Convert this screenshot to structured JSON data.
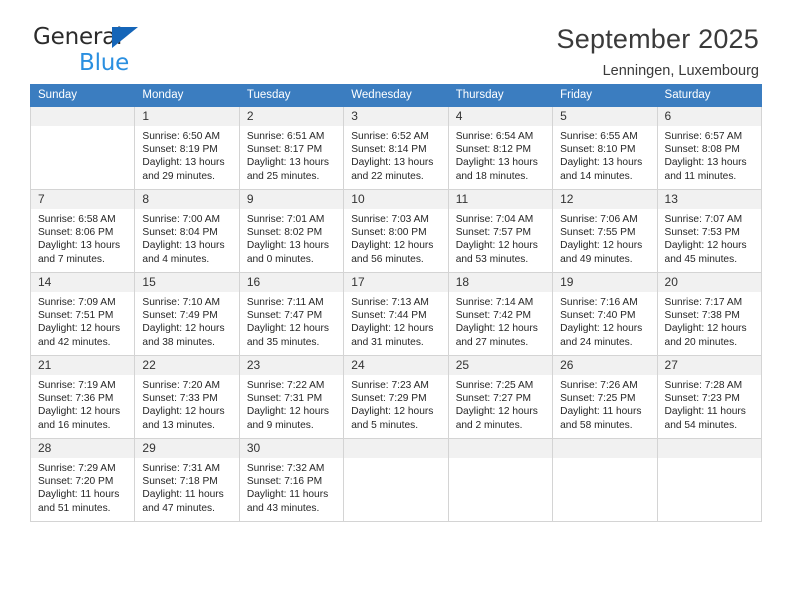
{
  "brand": {
    "line1": "General",
    "line2": "Blue",
    "triangle_color": "#1565b8",
    "blue_text_color": "#2a8fe0"
  },
  "header": {
    "title": "September 2025",
    "subtitle": "Lenningen, Luxembourg",
    "header_bg_color": "#3b7dc0",
    "daynum_bg_color": "#f1f1f1"
  },
  "weekday_headers": [
    "Sunday",
    "Monday",
    "Tuesday",
    "Wednesday",
    "Thursday",
    "Friday",
    "Saturday"
  ],
  "weeks": [
    [
      {
        "day": ""
      },
      {
        "day": "1",
        "sunrise": "Sunrise: 6:50 AM",
        "sunset": "Sunset: 8:19 PM",
        "daylight_1": "Daylight: 13 hours",
        "daylight_2": "and 29 minutes."
      },
      {
        "day": "2",
        "sunrise": "Sunrise: 6:51 AM",
        "sunset": "Sunset: 8:17 PM",
        "daylight_1": "Daylight: 13 hours",
        "daylight_2": "and 25 minutes."
      },
      {
        "day": "3",
        "sunrise": "Sunrise: 6:52 AM",
        "sunset": "Sunset: 8:14 PM",
        "daylight_1": "Daylight: 13 hours",
        "daylight_2": "and 22 minutes."
      },
      {
        "day": "4",
        "sunrise": "Sunrise: 6:54 AM",
        "sunset": "Sunset: 8:12 PM",
        "daylight_1": "Daylight: 13 hours",
        "daylight_2": "and 18 minutes."
      },
      {
        "day": "5",
        "sunrise": "Sunrise: 6:55 AM",
        "sunset": "Sunset: 8:10 PM",
        "daylight_1": "Daylight: 13 hours",
        "daylight_2": "and 14 minutes."
      },
      {
        "day": "6",
        "sunrise": "Sunrise: 6:57 AM",
        "sunset": "Sunset: 8:08 PM",
        "daylight_1": "Daylight: 13 hours",
        "daylight_2": "and 11 minutes."
      }
    ],
    [
      {
        "day": "7",
        "sunrise": "Sunrise: 6:58 AM",
        "sunset": "Sunset: 8:06 PM",
        "daylight_1": "Daylight: 13 hours",
        "daylight_2": "and 7 minutes."
      },
      {
        "day": "8",
        "sunrise": "Sunrise: 7:00 AM",
        "sunset": "Sunset: 8:04 PM",
        "daylight_1": "Daylight: 13 hours",
        "daylight_2": "and 4 minutes."
      },
      {
        "day": "9",
        "sunrise": "Sunrise: 7:01 AM",
        "sunset": "Sunset: 8:02 PM",
        "daylight_1": "Daylight: 13 hours",
        "daylight_2": "and 0 minutes."
      },
      {
        "day": "10",
        "sunrise": "Sunrise: 7:03 AM",
        "sunset": "Sunset: 8:00 PM",
        "daylight_1": "Daylight: 12 hours",
        "daylight_2": "and 56 minutes."
      },
      {
        "day": "11",
        "sunrise": "Sunrise: 7:04 AM",
        "sunset": "Sunset: 7:57 PM",
        "daylight_1": "Daylight: 12 hours",
        "daylight_2": "and 53 minutes."
      },
      {
        "day": "12",
        "sunrise": "Sunrise: 7:06 AM",
        "sunset": "Sunset: 7:55 PM",
        "daylight_1": "Daylight: 12 hours",
        "daylight_2": "and 49 minutes."
      },
      {
        "day": "13",
        "sunrise": "Sunrise: 7:07 AM",
        "sunset": "Sunset: 7:53 PM",
        "daylight_1": "Daylight: 12 hours",
        "daylight_2": "and 45 minutes."
      }
    ],
    [
      {
        "day": "14",
        "sunrise": "Sunrise: 7:09 AM",
        "sunset": "Sunset: 7:51 PM",
        "daylight_1": "Daylight: 12 hours",
        "daylight_2": "and 42 minutes."
      },
      {
        "day": "15",
        "sunrise": "Sunrise: 7:10 AM",
        "sunset": "Sunset: 7:49 PM",
        "daylight_1": "Daylight: 12 hours",
        "daylight_2": "and 38 minutes."
      },
      {
        "day": "16",
        "sunrise": "Sunrise: 7:11 AM",
        "sunset": "Sunset: 7:47 PM",
        "daylight_1": "Daylight: 12 hours",
        "daylight_2": "and 35 minutes."
      },
      {
        "day": "17",
        "sunrise": "Sunrise: 7:13 AM",
        "sunset": "Sunset: 7:44 PM",
        "daylight_1": "Daylight: 12 hours",
        "daylight_2": "and 31 minutes."
      },
      {
        "day": "18",
        "sunrise": "Sunrise: 7:14 AM",
        "sunset": "Sunset: 7:42 PM",
        "daylight_1": "Daylight: 12 hours",
        "daylight_2": "and 27 minutes."
      },
      {
        "day": "19",
        "sunrise": "Sunrise: 7:16 AM",
        "sunset": "Sunset: 7:40 PM",
        "daylight_1": "Daylight: 12 hours",
        "daylight_2": "and 24 minutes."
      },
      {
        "day": "20",
        "sunrise": "Sunrise: 7:17 AM",
        "sunset": "Sunset: 7:38 PM",
        "daylight_1": "Daylight: 12 hours",
        "daylight_2": "and 20 minutes."
      }
    ],
    [
      {
        "day": "21",
        "sunrise": "Sunrise: 7:19 AM",
        "sunset": "Sunset: 7:36 PM",
        "daylight_1": "Daylight: 12 hours",
        "daylight_2": "and 16 minutes."
      },
      {
        "day": "22",
        "sunrise": "Sunrise: 7:20 AM",
        "sunset": "Sunset: 7:33 PM",
        "daylight_1": "Daylight: 12 hours",
        "daylight_2": "and 13 minutes."
      },
      {
        "day": "23",
        "sunrise": "Sunrise: 7:22 AM",
        "sunset": "Sunset: 7:31 PM",
        "daylight_1": "Daylight: 12 hours",
        "daylight_2": "and 9 minutes."
      },
      {
        "day": "24",
        "sunrise": "Sunrise: 7:23 AM",
        "sunset": "Sunset: 7:29 PM",
        "daylight_1": "Daylight: 12 hours",
        "daylight_2": "and 5 minutes."
      },
      {
        "day": "25",
        "sunrise": "Sunrise: 7:25 AM",
        "sunset": "Sunset: 7:27 PM",
        "daylight_1": "Daylight: 12 hours",
        "daylight_2": "and 2 minutes."
      },
      {
        "day": "26",
        "sunrise": "Sunrise: 7:26 AM",
        "sunset": "Sunset: 7:25 PM",
        "daylight_1": "Daylight: 11 hours",
        "daylight_2": "and 58 minutes."
      },
      {
        "day": "27",
        "sunrise": "Sunrise: 7:28 AM",
        "sunset": "Sunset: 7:23 PM",
        "daylight_1": "Daylight: 11 hours",
        "daylight_2": "and 54 minutes."
      }
    ],
    [
      {
        "day": "28",
        "sunrise": "Sunrise: 7:29 AM",
        "sunset": "Sunset: 7:20 PM",
        "daylight_1": "Daylight: 11 hours",
        "daylight_2": "and 51 minutes."
      },
      {
        "day": "29",
        "sunrise": "Sunrise: 7:31 AM",
        "sunset": "Sunset: 7:18 PM",
        "daylight_1": "Daylight: 11 hours",
        "daylight_2": "and 47 minutes."
      },
      {
        "day": "30",
        "sunrise": "Sunrise: 7:32 AM",
        "sunset": "Sunset: 7:16 PM",
        "daylight_1": "Daylight: 11 hours",
        "daylight_2": "and 43 minutes."
      },
      {
        "day": ""
      },
      {
        "day": ""
      },
      {
        "day": ""
      },
      {
        "day": ""
      }
    ]
  ]
}
